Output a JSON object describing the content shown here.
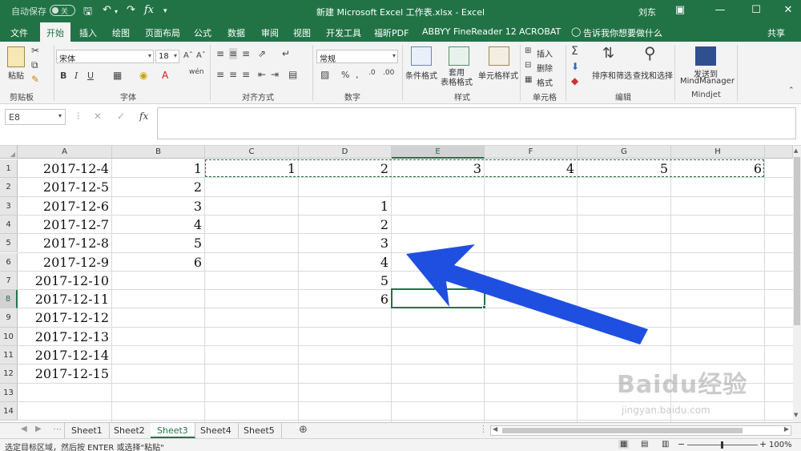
{
  "titlebar": {
    "autosave_label": "自动保存",
    "autosave_state": "关",
    "title": "新建 Microsoft Excel 工作表.xlsx  -  Excel",
    "user": "刘东"
  },
  "tabs": [
    "文件",
    "开始",
    "插入",
    "绘图",
    "页面布局",
    "公式",
    "数据",
    "审阅",
    "视图",
    "开发工具",
    "福昕PDF",
    "ABBYY FineReader 12",
    "ACROBAT"
  ],
  "tell_me": "告诉我你想要做什么",
  "share": "共享",
  "ribbon": {
    "paste": "粘贴",
    "clipboard": "剪贴板",
    "font_name": "宋体",
    "font_size": "18",
    "font_group": "字体",
    "align_group": "对齐方式",
    "number_format": "常规",
    "number_group": "数字",
    "cond_format": "条件格式",
    "table_format": "套用\n表格格式",
    "cell_style": "单元格样式",
    "styles_group": "样式",
    "insert": "插入",
    "delete": "删除",
    "format": "格式",
    "cells_group": "单元格",
    "sort_filter": "排序和筛选",
    "find_select": "查找和选择",
    "edit_group": "编辑",
    "send_to": "发送到",
    "mindmanager": "MindManager",
    "mindjet_group": "Mindjet"
  },
  "formula_bar": {
    "name_box": "E8",
    "formula": ""
  },
  "grid": {
    "columns": [
      "A",
      "B",
      "C",
      "D",
      "E",
      "F",
      "G",
      "H"
    ],
    "selected_column": "E",
    "rows": [
      "1",
      "2",
      "3",
      "4",
      "5",
      "6",
      "7",
      "8",
      "9",
      "10",
      "11",
      "12",
      "13",
      "14"
    ],
    "selected_row": "8",
    "col_a": [
      "2017-12-4",
      "2017-12-5",
      "2017-12-6",
      "2017-12-7",
      "2017-12-8",
      "2017-12-9",
      "2017-12-10",
      "2017-12-11",
      "2017-12-12",
      "2017-12-13",
      "2017-12-14",
      "2017-12-15"
    ],
    "col_b": [
      "1",
      "2",
      "3",
      "4",
      "5",
      "6"
    ],
    "row1_c_to_h": [
      "1",
      "2",
      "3",
      "4",
      "5",
      "6"
    ],
    "col_d_rows_3_to_8": [
      "1",
      "2",
      "3",
      "4",
      "5",
      "6"
    ]
  },
  "sheets": [
    "Sheet1",
    "Sheet2",
    "Sheet3",
    "Sheet4",
    "Sheet5"
  ],
  "active_sheet": "Sheet3",
  "status": {
    "message": "选定目标区域，然后按 ENTER 或选择\"粘贴\"",
    "zoom": "100%"
  },
  "watermark": {
    "brand": "Baidu经验",
    "url": "jingyan.baidu.com"
  },
  "colors": {
    "excel_green": "#217346",
    "arrow_blue": "#1f4fe0"
  }
}
